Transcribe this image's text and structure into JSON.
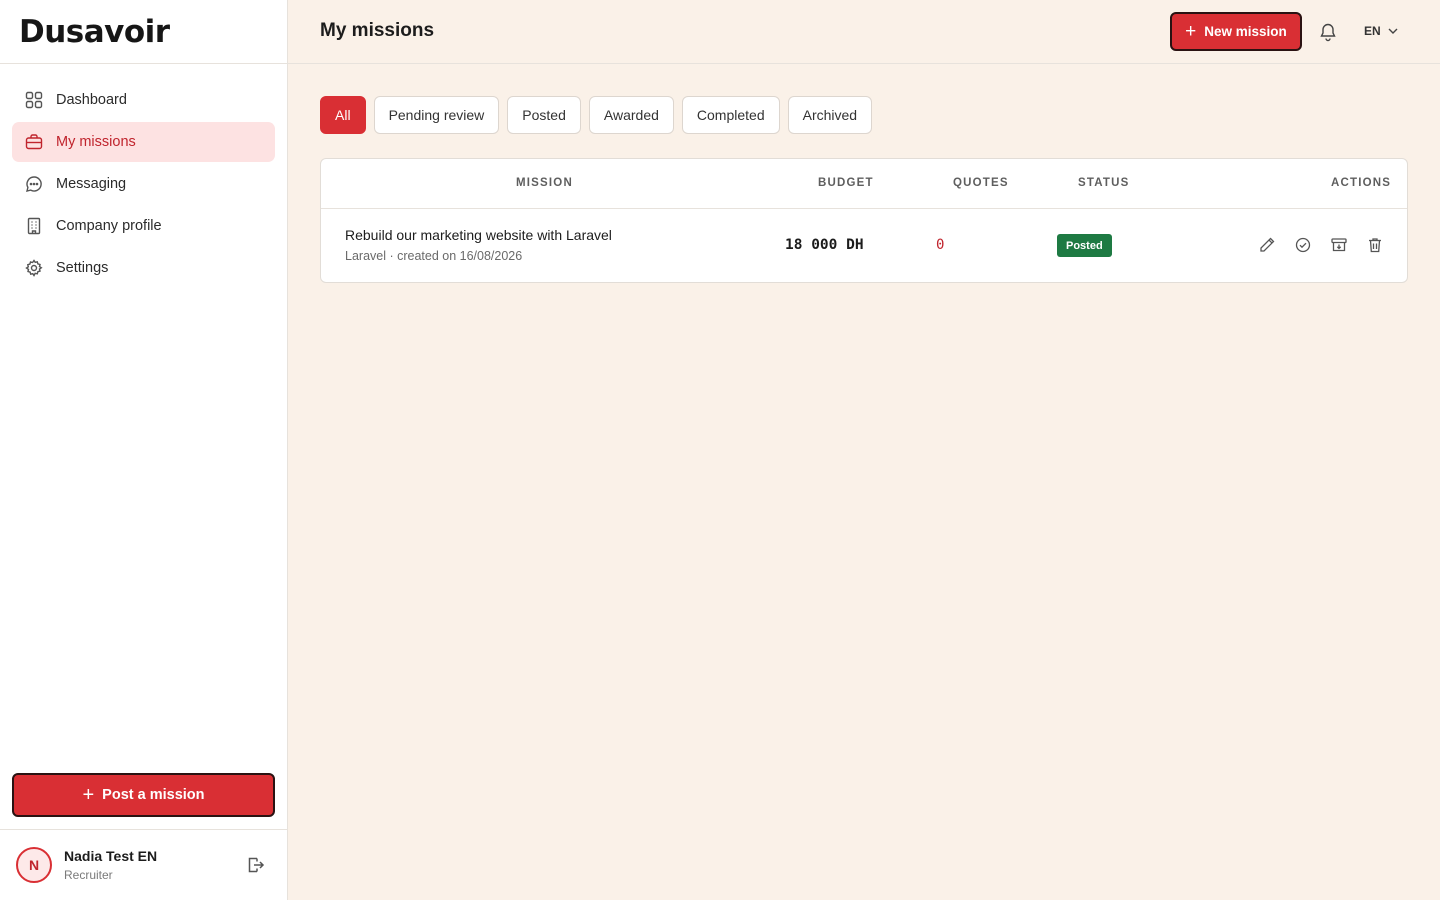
{
  "app": {
    "logo": "Dusavoir",
    "accent": "#d92f34"
  },
  "sidebar": {
    "items": [
      {
        "label": "Dashboard",
        "icon": "grid-icon"
      },
      {
        "label": "My missions",
        "icon": "briefcase-icon",
        "active": true
      },
      {
        "label": "Messaging",
        "icon": "chat-icon"
      },
      {
        "label": "Company profile",
        "icon": "building-icon"
      },
      {
        "label": "Settings",
        "icon": "gear-icon"
      }
    ],
    "post_button": "Post a mission",
    "user": {
      "initial": "N",
      "name": "Nadia Test EN",
      "role": "Recruiter"
    }
  },
  "header": {
    "title": "My missions",
    "new_button": "New mission",
    "language": "EN"
  },
  "tabs": [
    {
      "label": "All",
      "active": true
    },
    {
      "label": "Pending review"
    },
    {
      "label": "Posted"
    },
    {
      "label": "Awarded"
    },
    {
      "label": "Completed"
    },
    {
      "label": "Archived"
    }
  ],
  "table": {
    "columns": [
      "MISSION",
      "BUDGET",
      "QUOTES",
      "STATUS",
      "ACTIONS"
    ],
    "rows": [
      {
        "title": "Rebuild our marketing website with Laravel",
        "subtitle": "Laravel · created on 16/08/2026",
        "budget": "18 000 DH",
        "quotes": "0",
        "status": "Posted",
        "status_color": "#1e7a43"
      }
    ]
  }
}
